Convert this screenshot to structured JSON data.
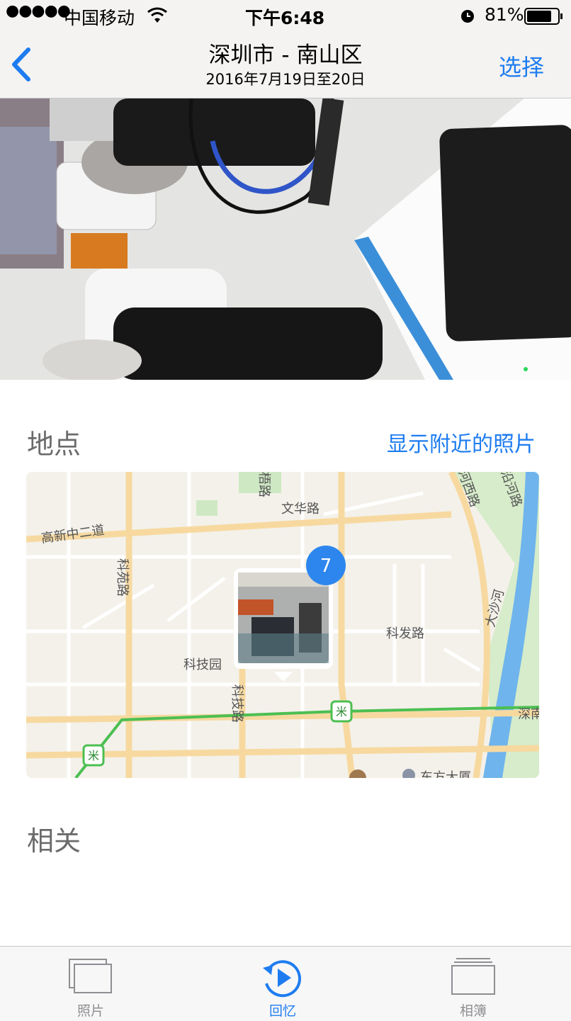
{
  "status_bar": {
    "signal": "●●●●●",
    "carrier": "中国移动",
    "time": "下午6:48",
    "battery_percent": "81%",
    "battery_level": 0.81
  },
  "nav": {
    "title": "深圳市 - 南山区",
    "subtitle": "2016年7月19日至20日",
    "select_label": "选择"
  },
  "places": {
    "title": "地点",
    "nearby_link": "显示附近的照片",
    "photo_count": "7",
    "map_labels": {
      "gaoxin": "高新中二道",
      "kewan": "科苑路",
      "wenhua": "文华路",
      "kejiyuan": "科技园",
      "keji_road": "科技路",
      "kefa": "科发路",
      "dashahe": "大沙河",
      "hexi": "河西路",
      "yanhe": "沿河路",
      "shen": "深南",
      "top_road": "梧路",
      "dongfang": "东方大厦"
    }
  },
  "related": {
    "title": "相关"
  },
  "tabbar": {
    "tabs": [
      {
        "label": "照片",
        "icon": "photos-icon"
      },
      {
        "label": "回忆",
        "icon": "memories-icon",
        "active": true
      },
      {
        "label": "相簿",
        "icon": "albums-icon"
      }
    ]
  },
  "colors": {
    "accent": "#1e7cf0",
    "active_tab": "#1e7cf0",
    "inactive_tab": "#8e8e93"
  }
}
